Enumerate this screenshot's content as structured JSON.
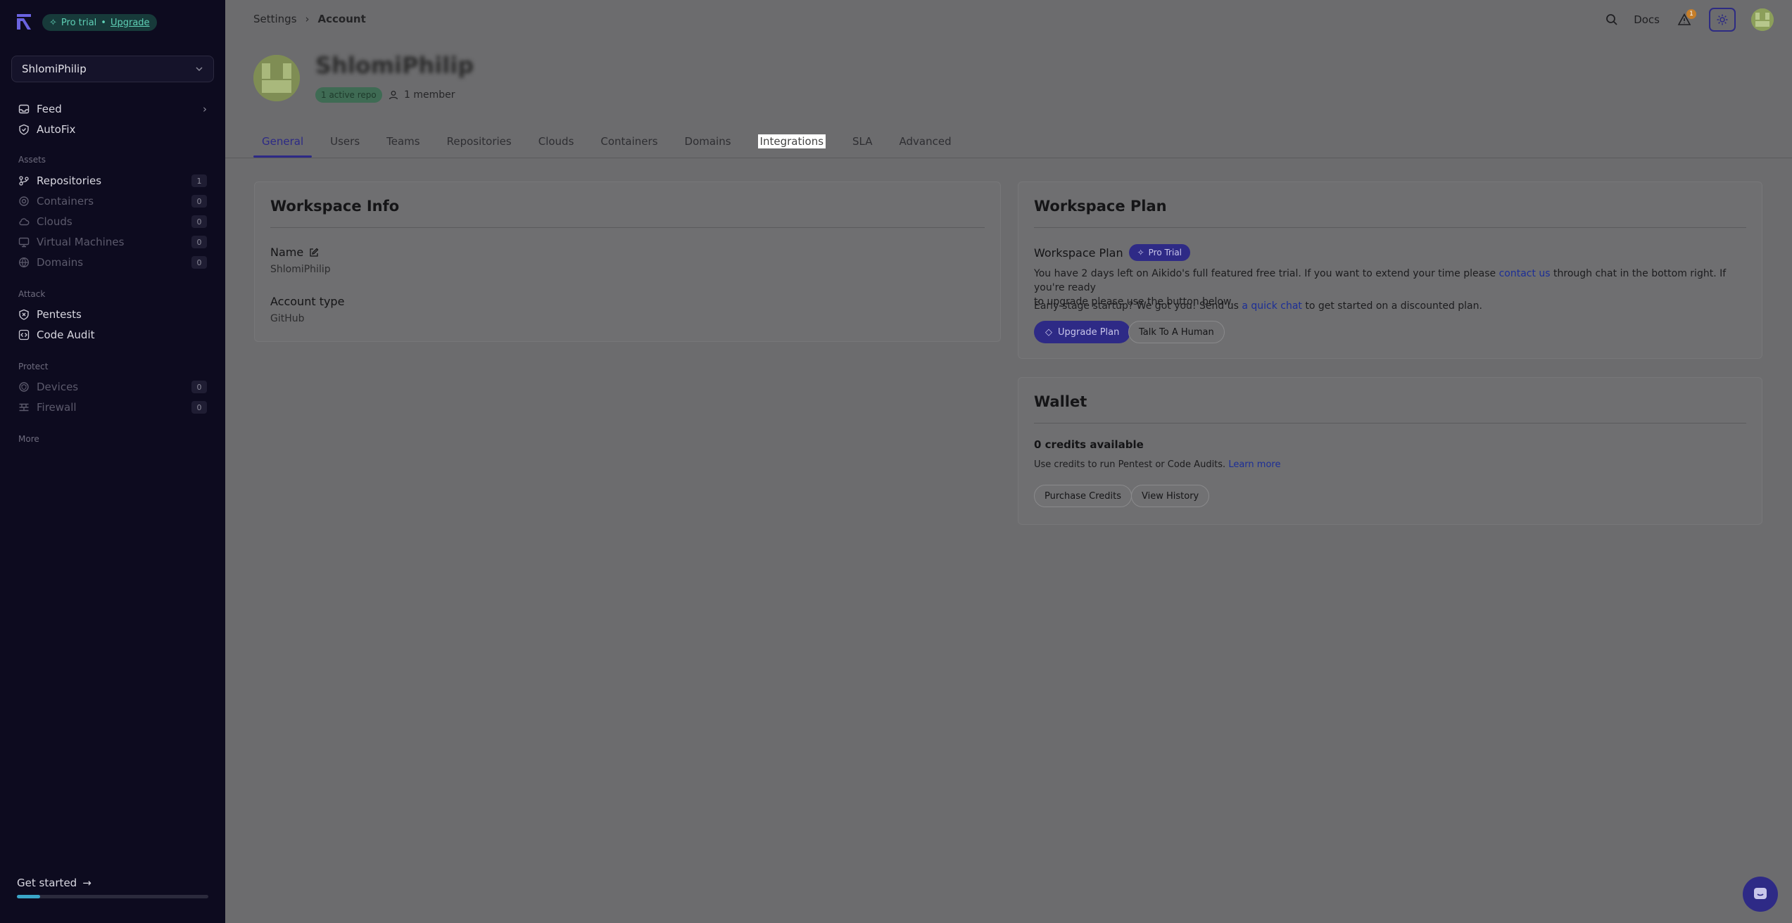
{
  "sidebar": {
    "trial_badge": {
      "label": "Pro trial",
      "separator": "•",
      "upgrade": "Upgrade"
    },
    "workspace": "ShlomiPhilip",
    "primary": [
      {
        "label": "Feed",
        "icon": "inbox-icon"
      },
      {
        "label": "AutoFix",
        "icon": "shield-icon"
      }
    ],
    "sections": {
      "assets": "Assets",
      "attack": "Attack",
      "protect": "Protect",
      "more": "More"
    },
    "assets": [
      {
        "label": "Repositories",
        "count": "1",
        "icon": "repository-icon"
      },
      {
        "label": "Containers",
        "count": "0",
        "icon": "container-icon"
      },
      {
        "label": "Clouds",
        "count": "0",
        "icon": "cloud-icon"
      },
      {
        "label": "Virtual Machines",
        "count": "0",
        "icon": "monitor-icon"
      },
      {
        "label": "Domains",
        "count": "0",
        "icon": "globe-icon"
      }
    ],
    "attack": [
      {
        "label": "Pentests",
        "icon": "pentest-icon"
      },
      {
        "label": "Code Audit",
        "icon": "code-icon"
      }
    ],
    "protect": [
      {
        "label": "Devices",
        "count": "0",
        "icon": "device-icon"
      },
      {
        "label": "Firewall",
        "count": "0",
        "icon": "firewall-icon"
      }
    ],
    "get_started": "Get started",
    "progress": 0.12
  },
  "header": {
    "breadcrumb": [
      "Settings",
      "Account"
    ],
    "docs": "Docs",
    "notification_count": "1"
  },
  "account": {
    "name": "ShlomiPhilip",
    "repo_badge": "1 active repo",
    "members": "1 member"
  },
  "tabs": [
    "General",
    "Users",
    "Teams",
    "Repositories",
    "Clouds",
    "Containers",
    "Domains",
    "Integrations",
    "SLA",
    "Advanced"
  ],
  "workspace_info": {
    "title": "Workspace Info",
    "name_label": "Name",
    "name_value": "ShlomiPhilip",
    "type_label": "Account type",
    "type_value": "GitHub"
  },
  "workspace_plan": {
    "title": "Workspace Plan",
    "label": "Workspace Plan",
    "pill": "Pro Trial",
    "text1_a": "You have 2 days left on Aikido's full featured free trial. If you want to extend your time please ",
    "text1_link": "contact us",
    "text1_b": " through chat in the bottom right. If you're ready",
    "text1_c": "to upgrade please use the button below.",
    "text2_a": "Early-stage startup? We got you! Send us ",
    "text2_link": "a quick chat",
    "text2_b": " to get started on a discounted plan.",
    "upgrade_btn": "Upgrade Plan",
    "talk_btn": "Talk To A Human"
  },
  "wallet": {
    "title": "Wallet",
    "credits": "0 credits available",
    "desc": "Use credits to run Pentest or Code Audits.",
    "learn_more": "Learn more",
    "purchase_btn": "Purchase Credits",
    "history_btn": "View History"
  }
}
